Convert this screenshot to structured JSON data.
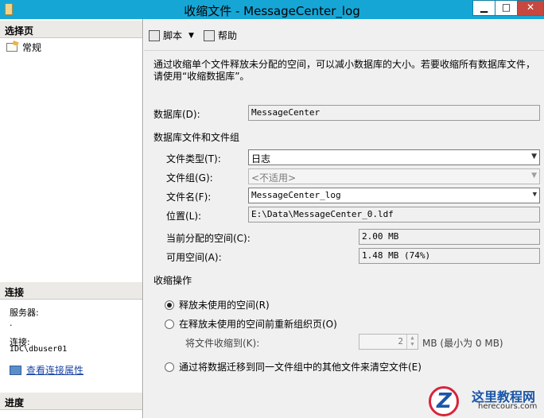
{
  "window": {
    "title": "收缩文件 - MessageCenter_log",
    "min_glyph": "▁",
    "max_glyph": "□",
    "close_glyph": "✕"
  },
  "left_pane": {
    "select_page_header": "选择页",
    "pages": [
      {
        "label": "常规",
        "icon": "page-icon"
      }
    ],
    "connection_header": "连接",
    "server_label": "服务器:",
    "server_value": ".",
    "connection_label": "连接:",
    "connection_value": "IDC\\dbuser01",
    "view_props_link": "查看连接属性",
    "progress_header": "进度"
  },
  "toolbar": {
    "script_label": "脚本",
    "help_label": "帮助"
  },
  "main": {
    "description": "通过收缩单个文件释放未分配的空间，可以减小数据库的大小。若要收缩所有数据库文件，请使用“收缩数据库”。",
    "database_label": "数据库(D):",
    "database_value": "MessageCenter",
    "files_group_label": "数据库文件和文件组",
    "file_type_label": "文件类型(T):",
    "file_type_value": "日志",
    "filegroup_label": "文件组(G):",
    "filegroup_value": "<不适用>",
    "filename_label": "文件名(F):",
    "filename_value": "MessageCenter_log",
    "location_label": "位置(L):",
    "location_value": "E:\\Data\\MessageCenter_0.ldf",
    "allocated_label": "当前分配的空间(C):",
    "allocated_value": "2.00 MB",
    "available_label": "可用空间(A):",
    "available_value": "1.48 MB (74%)",
    "shrink_ops_label": "收缩操作",
    "opt_release": "释放未使用的空间(R)",
    "opt_reorganize": "在释放未使用的空间前重新组织页(O)",
    "shrink_to_label": "将文件收缩到(K):",
    "shrink_to_value": "2",
    "shrink_to_unit": "MB (最小为 0 MB)",
    "opt_empty": "通过将数据迁移到同一文件组中的其他文件来清空文件(E)",
    "selected_option": "release"
  },
  "watermark": {
    "logo_letter": "Z",
    "site_name": "这里教程网",
    "site_url": "herecours.com"
  }
}
